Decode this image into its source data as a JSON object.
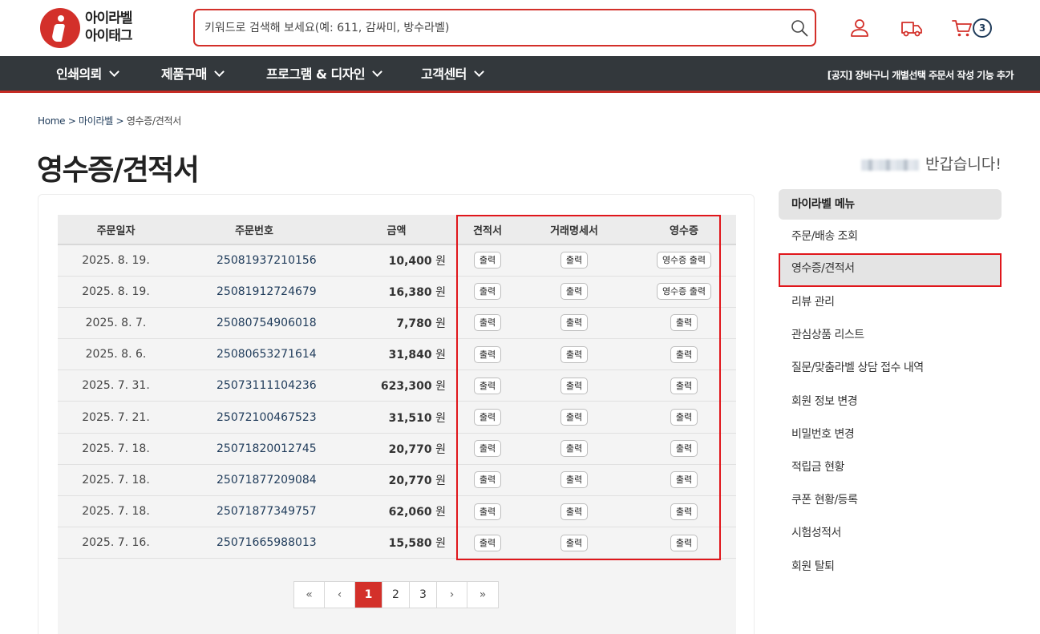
{
  "brand": {
    "line1": "아이라벨",
    "line2": "아이태그"
  },
  "search": {
    "placeholder": "키워드로 검색해 보세요(예: 611, 감싸미, 방수라벨)"
  },
  "header_icons": [
    "user-icon",
    "truck-icon",
    "cart-icon"
  ],
  "cart": {
    "count": "3"
  },
  "nav": {
    "items": [
      "인쇄의뢰",
      "제품구매",
      "프로그램 & 디자인",
      "고객센터"
    ],
    "notice": "[공지] 장바구니 개별선택 주문서 작성 기능 추가"
  },
  "breadcrumb": {
    "home": "Home",
    "sep": ">",
    "parent": "마이라벨",
    "current": "영수증/견적서"
  },
  "page_title": "영수증/견적서",
  "greeting": "반갑습니다!",
  "table": {
    "headers": [
      "주문일자",
      "주문번호",
      "금액",
      "견적서",
      "거래명세서",
      "영수증"
    ],
    "currency": "원",
    "print_label": "출력",
    "receipt_print_label": "영수증 출력",
    "rows": [
      {
        "date": "2025. 8. 19.",
        "order_no": "25081937210156",
        "amount": "10,400",
        "receipt": "영수증 출력"
      },
      {
        "date": "2025. 8. 19.",
        "order_no": "25081912724679",
        "amount": "16,380",
        "receipt": "영수증 출력"
      },
      {
        "date": "2025. 8. 7.",
        "order_no": "25080754906018",
        "amount": "7,780",
        "receipt": "출력"
      },
      {
        "date": "2025. 8. 6.",
        "order_no": "25080653271614",
        "amount": "31,840",
        "receipt": "출력"
      },
      {
        "date": "2025. 7. 31.",
        "order_no": "25073111104236",
        "amount": "623,300",
        "receipt": "출력"
      },
      {
        "date": "2025. 7. 21.",
        "order_no": "25072100467523",
        "amount": "31,510",
        "receipt": "출력"
      },
      {
        "date": "2025. 7. 18.",
        "order_no": "25071820012745",
        "amount": "20,770",
        "receipt": "출력"
      },
      {
        "date": "2025. 7. 18.",
        "order_no": "25071877209084",
        "amount": "20,770",
        "receipt": "출력"
      },
      {
        "date": "2025. 7. 18.",
        "order_no": "25071877349757",
        "amount": "62,060",
        "receipt": "출력"
      },
      {
        "date": "2025. 7. 16.",
        "order_no": "25071665988013",
        "amount": "15,580",
        "receipt": "출력"
      }
    ]
  },
  "pagination": {
    "first": "«",
    "prev": "‹",
    "pages": [
      "1",
      "2",
      "3"
    ],
    "current": "1",
    "next": "›",
    "last": "»"
  },
  "sidebar": {
    "title": "마이라벨 메뉴",
    "items": [
      "주문/배송 조회",
      "영수증/견적서",
      "리뷰 관리",
      "관심상품 리스트",
      "질문/맞춤라벨 상담 접수 내역",
      "회원 정보 변경",
      "비밀번호 변경",
      "적립금 현황",
      "쿠폰 현황/등록",
      "시험성적서",
      "회원 탈퇴"
    ],
    "active": "영수증/견적서"
  },
  "colors": {
    "brand_red": "#d3302a",
    "nav_bg": "#33383c",
    "link_navy": "#1f3b5a",
    "highlight": "#e0161b"
  }
}
